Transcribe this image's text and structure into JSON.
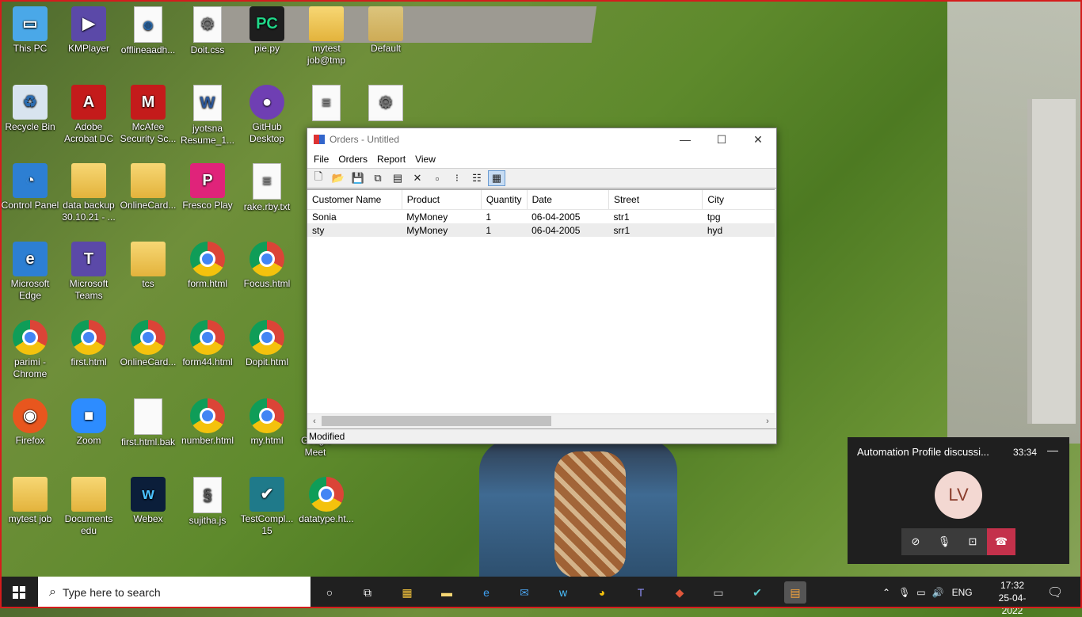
{
  "desktop": {
    "icons": [
      {
        "label": "This PC",
        "x": "",
        "type": "pc"
      },
      {
        "label": "KMPlayer"
      },
      {
        "label": "offlineaadh..."
      },
      {
        "label": "Doit.css"
      },
      {
        "label": "pie.py"
      },
      {
        "label": "mytest job@tmp"
      },
      {
        "label": "Default"
      },
      {
        "label": "Recycle Bin"
      },
      {
        "label": "Adobe Acrobat DC"
      },
      {
        "label": "McAfee Security Sc..."
      },
      {
        "label": "jyotsna Resume_1..."
      },
      {
        "label": "GitHub Desktop"
      },
      {
        "label": "Control Panel"
      },
      {
        "label": "data backup 30.10.21 - ..."
      },
      {
        "label": "OnlineCard..."
      },
      {
        "label": "Fresco Play"
      },
      {
        "label": "rake.rby.txt"
      },
      {
        "label": "Microsoft Edge"
      },
      {
        "label": "Microsoft Teams"
      },
      {
        "label": "tcs"
      },
      {
        "label": "form.html"
      },
      {
        "label": "Focus.html"
      },
      {
        "label": "parimi - Chrome"
      },
      {
        "label": "first.html"
      },
      {
        "label": "OnlineCard..."
      },
      {
        "label": "form44.html"
      },
      {
        "label": "Dopit.html"
      },
      {
        "label": "Firefox"
      },
      {
        "label": "Zoom"
      },
      {
        "label": "first.html.bak"
      },
      {
        "label": "number.html"
      },
      {
        "label": "my.html"
      },
      {
        "label": "Google Meet"
      },
      {
        "label": "mytest job"
      },
      {
        "label": "Documents edu"
      },
      {
        "label": "Webex"
      },
      {
        "label": "sujitha.js"
      },
      {
        "label": "TestCompl... 15"
      },
      {
        "label": "datatype.ht..."
      }
    ],
    "pc_label": "PC"
  },
  "orders_window": {
    "title": "Orders - Untitled",
    "menu": [
      "File",
      "Orders",
      "Report",
      "View"
    ],
    "columns": [
      "Customer Name",
      "Product",
      "Quantity",
      "Date",
      "Street",
      "City"
    ],
    "rows": [
      [
        "Sonia",
        "MyMoney",
        "1",
        "06-04-2005",
        "str1",
        "tpg"
      ],
      [
        "sty",
        "MyMoney",
        "1",
        "06-04-2005",
        "srr1",
        "hyd"
      ]
    ],
    "status": "Modified",
    "toolbar_icons": [
      "new-icon",
      "open-icon",
      "save-icon",
      "copy-icon",
      "properties-icon",
      "delete-icon",
      "large-icons-icon",
      "small-icons-icon",
      "list-view-icon",
      "details-view-icon"
    ]
  },
  "teams_call": {
    "title": "Automation Profile discussi...",
    "duration": "33:34",
    "avatar_initials": "LV"
  },
  "taskbar": {
    "search_placeholder": "Type here to search",
    "language": "ENG",
    "time": "17:32",
    "date": "25-04-2022"
  },
  "colors": {
    "frame": "#d51c1c",
    "taskbar": "#202020",
    "hangup": "#c4314b"
  }
}
